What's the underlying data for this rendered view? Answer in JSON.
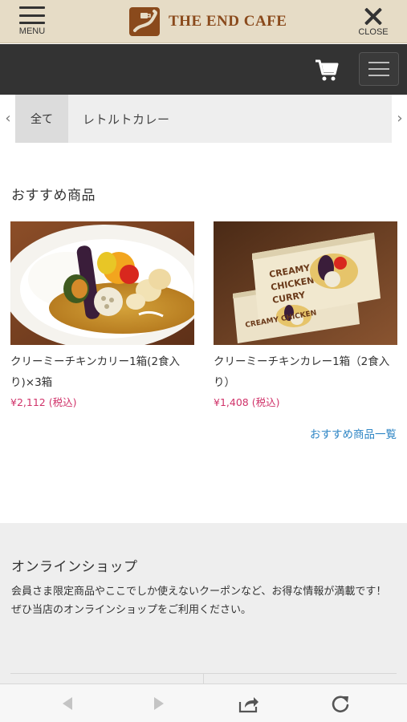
{
  "header": {
    "menu_label": "MENU",
    "logo_text": "THE END CAFE",
    "close_label": "CLOSE"
  },
  "icons": {
    "menu": "hamburger-icon",
    "logo": "cafe-logo-mark",
    "close": "close-icon",
    "cart": "cart-icon",
    "nav_toggle": "hamburger-icon",
    "prev": "chevron-left-icon",
    "next": "chevron-right-icon",
    "browser_back": "triangle-left-icon",
    "browser_forward": "triangle-right-icon",
    "browser_share": "share-icon",
    "browser_reload": "reload-icon"
  },
  "categories": {
    "prev_arrow": "‹",
    "next_arrow": "›",
    "items": [
      {
        "label": "全て",
        "active": true
      },
      {
        "label": "レトルトカレー",
        "active": false
      }
    ]
  },
  "recommended": {
    "title": "おすすめ商品",
    "products": [
      {
        "name": "クリーミーチキンカリー1箱(2食入り)×3箱",
        "price": "¥2,112",
        "tax": "(税込)"
      },
      {
        "name": "クリーミーチキンカレー1箱（2食入り）",
        "price": "¥1,408",
        "tax": "(税込)"
      }
    ],
    "more_link": "おすすめ商品一覧"
  },
  "online_shop": {
    "title": "オンラインショップ",
    "description": "会員さま限定商品やここでしか使えないクーポンなど、お得な情報が満載です！",
    "description2": "ぜひ当店のオンラインショップをご利用ください。"
  },
  "colors": {
    "header_bg": "#e6dcc6",
    "nav_bg": "#333333",
    "brand": "#8a4a1c",
    "price": "#d0336a",
    "link": "#2f86c5",
    "section_bg": "#eeeeee"
  }
}
